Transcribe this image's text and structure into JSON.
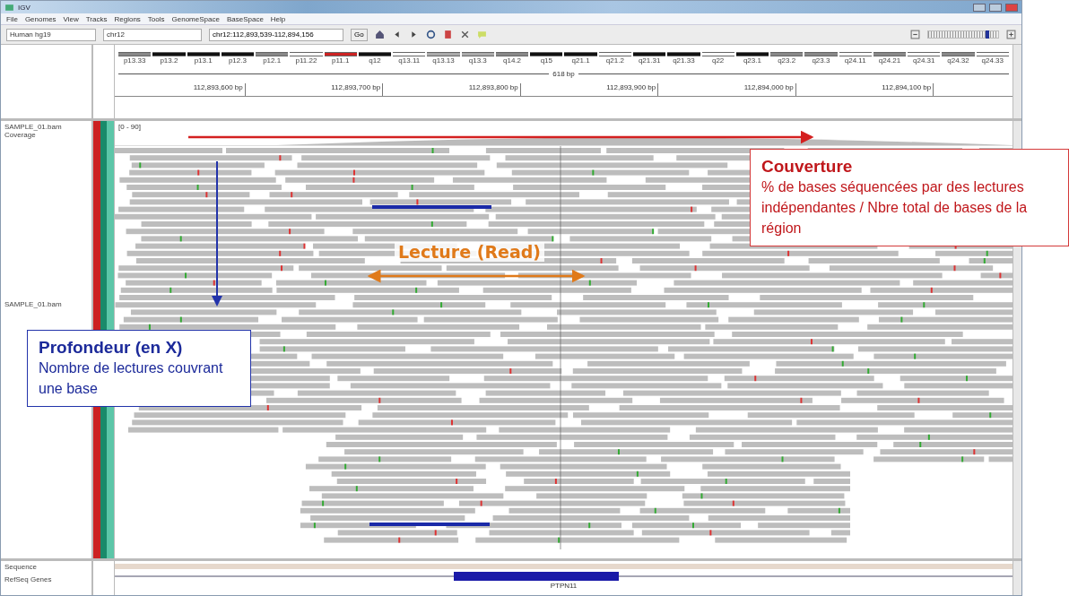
{
  "window": {
    "title": "IGV"
  },
  "menu": [
    "File",
    "Genomes",
    "View",
    "Tracks",
    "Regions",
    "Tools",
    "GenomeSpace",
    "BaseSpace",
    "Help"
  ],
  "toolbar": {
    "genome": "Human hg19",
    "chromosome": "chr12",
    "locus": "chr12:112,893,539-112,894,156",
    "go": "Go",
    "zoom": {
      "level": 0.84
    }
  },
  "ideogram": {
    "bands": [
      {
        "label": "p13.33",
        "color": "#888888"
      },
      {
        "label": "p13.2",
        "color": "#111111"
      },
      {
        "label": "p13.1",
        "color": "#111111"
      },
      {
        "label": "p12.3",
        "color": "#111111"
      },
      {
        "label": "p12.1",
        "color": "#888888"
      },
      {
        "label": "p11.22",
        "color": "#ffffff"
      },
      {
        "label": "p11.1",
        "color": "#cc2222"
      },
      {
        "label": "q12",
        "color": "#111111"
      },
      {
        "label": "q13.11",
        "color": "#ffffff"
      },
      {
        "label": "q13.13",
        "color": "#aaaaaa"
      },
      {
        "label": "q13.3",
        "color": "#aaaaaa"
      },
      {
        "label": "q14.2",
        "color": "#888888"
      },
      {
        "label": "q15",
        "color": "#111111"
      },
      {
        "label": "q21.1",
        "color": "#111111"
      },
      {
        "label": "q21.2",
        "color": "#ffffff"
      },
      {
        "label": "q21.31",
        "color": "#111111"
      },
      {
        "label": "q21.33",
        "color": "#111111"
      },
      {
        "label": "q22",
        "color": "#ffffff"
      },
      {
        "label": "q23.1",
        "color": "#111111"
      },
      {
        "label": "q23.2",
        "color": "#888888"
      },
      {
        "label": "q23.3",
        "color": "#888888"
      },
      {
        "label": "q24.11",
        "color": "#ffffff"
      },
      {
        "label": "q24.21",
        "color": "#888888"
      },
      {
        "label": "q24.31",
        "color": "#ffffff"
      },
      {
        "label": "q24.32",
        "color": "#888888"
      },
      {
        "label": "q24.33",
        "color": "#ffffff"
      }
    ]
  },
  "ruler": {
    "span": "618 bp",
    "ticks": [
      "112,893,600 bp",
      "112,893,700 bp",
      "112,893,800 bp",
      "112,893,900 bp",
      "112,894,000 bp",
      "112,894,100 bp"
    ]
  },
  "tracks": {
    "coverage": {
      "name": "SAMPLE_01.bam Coverage",
      "range": "[0 - 90]"
    },
    "alignments": {
      "name": "SAMPLE_01.bam"
    },
    "sequence": {
      "name": "Sequence"
    },
    "genes": {
      "name": "RefSeq Genes",
      "gene": "PTPN11"
    }
  },
  "annotations": [
    {
      "kind": "coverage",
      "title": "Couverture",
      "text": "% de bases séquencées par des lectures indépendantes / Nbre total de bases de la région"
    },
    {
      "kind": "read",
      "title": "Lecture (Read)"
    },
    {
      "kind": "depth",
      "title": "Profondeur (en X)",
      "text": "Nombre de lectures couvrant une base"
    }
  ]
}
